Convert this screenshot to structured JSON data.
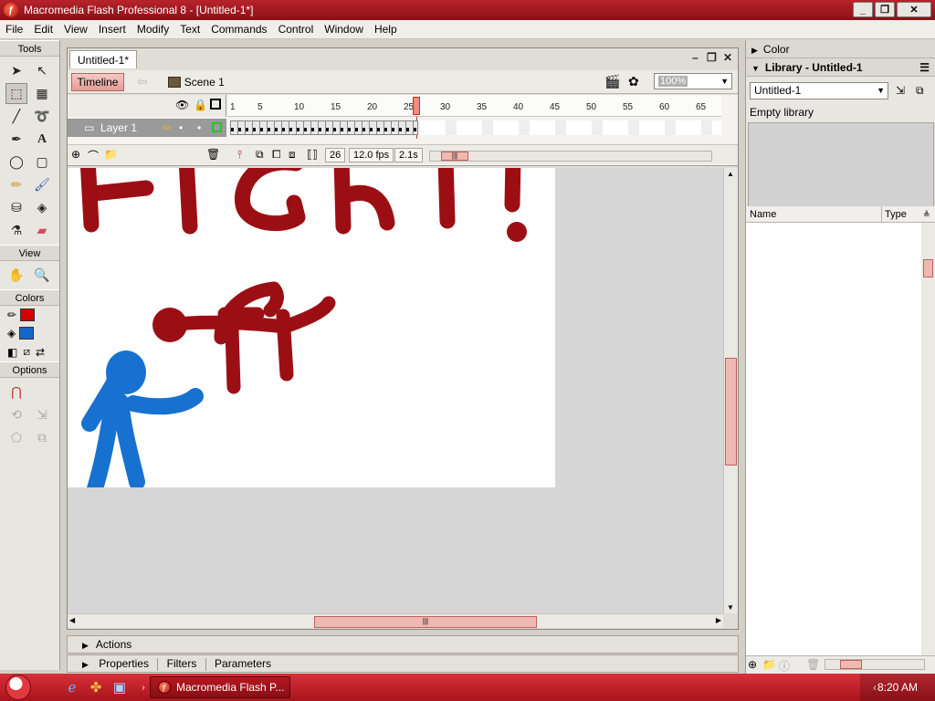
{
  "window": {
    "title": "Macromedia Flash Professional 8 - [Untitled-1*]",
    "app_icon_glyph": "ƒ"
  },
  "menu": [
    "File",
    "Edit",
    "View",
    "Insert",
    "Modify",
    "Text",
    "Commands",
    "Control",
    "Window",
    "Help"
  ],
  "tools_panel": {
    "tools_label": "Tools",
    "view_label": "View",
    "colors_label": "Colors",
    "options_label": "Options",
    "stroke_color": "#d40000",
    "fill_color": "#1466c8"
  },
  "document": {
    "tab": "Untitled-1*",
    "timeline_button": "Timeline",
    "scene": "Scene 1",
    "zoom": "100%"
  },
  "timeline": {
    "layer_name": "Layer 1",
    "ticks": [
      "1",
      "5",
      "10",
      "15",
      "20",
      "25",
      "30",
      "35",
      "40",
      "45",
      "50",
      "55",
      "60",
      "65"
    ],
    "current_frame": "26",
    "frame_rate": "12.0 fps",
    "elapsed": "2.1s"
  },
  "panels": {
    "actions": "Actions",
    "properties": "Properties",
    "filters": "Filters",
    "parameters": "Parameters"
  },
  "right_panel": {
    "color_title": "Color",
    "library_title": "Library - Untitled-1",
    "library_select": "Untitled-1",
    "empty": "Empty library",
    "col_name": "Name",
    "col_type": "Type"
  },
  "taskbar": {
    "task": "Macromedia Flash P...",
    "clock": "8:20 AM"
  },
  "colors": {
    "drawing_red": "#9b0f14",
    "drawing_blue": "#1771d0",
    "accent_pink": "#f0b8b3"
  }
}
